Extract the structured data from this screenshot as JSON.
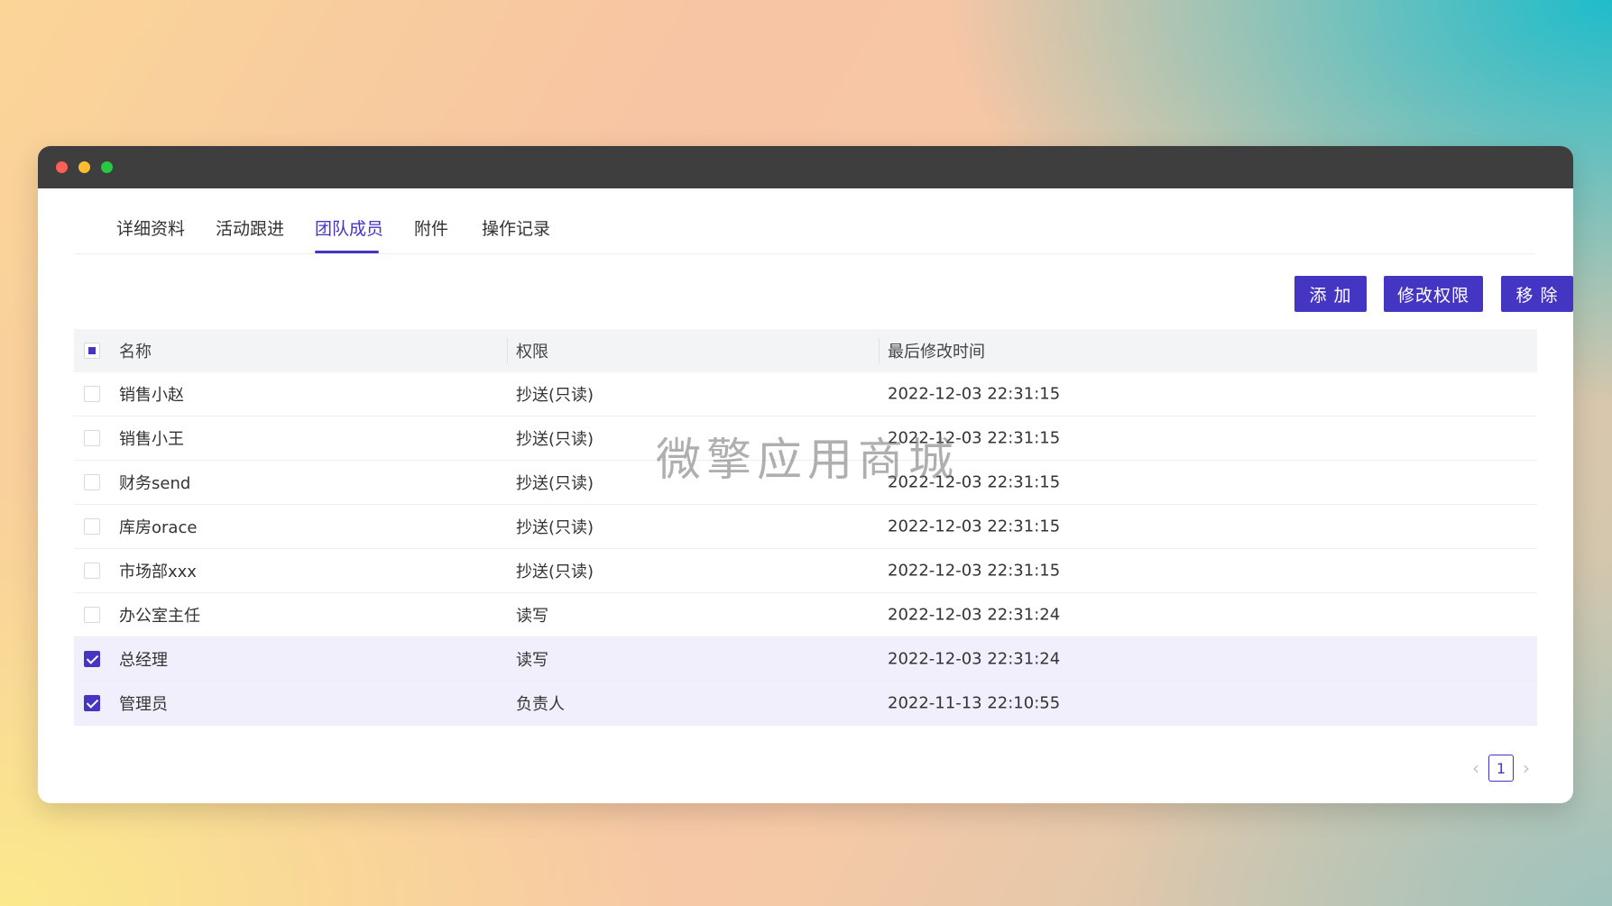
{
  "tabs": [
    {
      "label": "详细资料"
    },
    {
      "label": "活动跟进"
    },
    {
      "label": "团队成员"
    },
    {
      "label": "附件"
    },
    {
      "label": "操作记录"
    }
  ],
  "active_tab": "团队成员",
  "actions": {
    "add": "添 加",
    "edit_perm": "修改权限",
    "remove": "移 除"
  },
  "table": {
    "columns": [
      "名称",
      "权限",
      "最后修改时间"
    ],
    "header_checkbox": "partial",
    "rows": [
      {
        "name": "销售小赵",
        "permission": "抄送(只读)",
        "modified": "2022-12-03 22:31:15",
        "checked": false
      },
      {
        "name": "销售小王",
        "permission": "抄送(只读)",
        "modified": "2022-12-03 22:31:15",
        "checked": false
      },
      {
        "name": "财务send",
        "permission": "抄送(只读)",
        "modified": "2022-12-03 22:31:15",
        "checked": false
      },
      {
        "name": "库房orace",
        "permission": "抄送(只读)",
        "modified": "2022-12-03 22:31:15",
        "checked": false
      },
      {
        "name": "市场部xxx",
        "permission": "抄送(只读)",
        "modified": "2022-12-03 22:31:15",
        "checked": false
      },
      {
        "name": "办公室主任",
        "permission": "读写",
        "modified": "2022-12-03 22:31:24",
        "checked": false
      },
      {
        "name": "总经理",
        "permission": "读写",
        "modified": "2022-12-03 22:31:24",
        "checked": true
      },
      {
        "name": "管理员",
        "permission": "负责人",
        "modified": "2022-11-13 22:10:55",
        "checked": true
      }
    ]
  },
  "pagination": {
    "prev": "‹",
    "current": "1",
    "next": "›"
  },
  "watermark": "微擎应用商城",
  "colors": {
    "accent": "#4436c2",
    "titlebar": "#3e3e3e",
    "selected_row": "#f2effd"
  }
}
